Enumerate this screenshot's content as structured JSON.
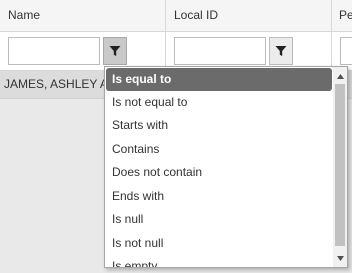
{
  "columns": {
    "name_header": "Name",
    "local_id_header": "Local ID",
    "third_header": "Pe"
  },
  "filters": {
    "name_value": "",
    "local_id_value": ""
  },
  "rows": [
    {
      "name": "JAMES, ASHLEY A"
    }
  ],
  "operator_menu": {
    "items": [
      "Is equal to",
      "Is not equal to",
      "Starts with",
      "Contains",
      "Does not contain",
      "Ends with",
      "Is null",
      "Is not null",
      "Is empty"
    ],
    "selected_index": 0
  },
  "icons": {
    "filter": "filter-icon",
    "scroll_up": "scroll-up-arrow-icon",
    "scroll_down": "scroll-down-arrow-icon"
  },
  "colors": {
    "selected_bg": "#6b6b6b",
    "header_bg": "#f5f5f5",
    "row_bg": "#dcdcdc"
  }
}
